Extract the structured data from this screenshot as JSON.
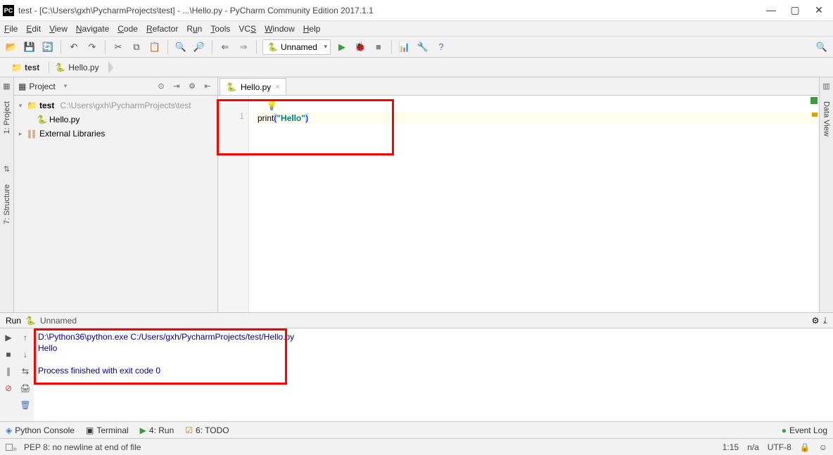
{
  "title": "test - [C:\\Users\\gxh\\PycharmProjects\\test] - ...\\Hello.py - PyCharm Community Edition 2017.1.1",
  "menu": [
    "File",
    "Edit",
    "View",
    "Navigate",
    "Code",
    "Refactor",
    "Run",
    "Tools",
    "VCS",
    "Window",
    "Help"
  ],
  "runConfig": "Unnamed",
  "breadcrumb": {
    "root": "test",
    "file": "Hello.py"
  },
  "sidebar": {
    "left": {
      "project": "1: Project",
      "structure": "7: Structure"
    },
    "right": {
      "dataview": "Data View"
    }
  },
  "projectPanel": {
    "label": "Project",
    "tree": {
      "rootName": "test",
      "rootPath": "C:\\Users\\gxh\\PycharmProjects\\test",
      "file": "Hello.py",
      "extLibs": "External Libraries"
    }
  },
  "editor": {
    "tabName": "Hello.py",
    "lineNo": "1",
    "code": {
      "fn": "print",
      "open": "(",
      "str": "\"Hello\"",
      "close": ")"
    }
  },
  "runPanel": {
    "label": "Run",
    "config": "Unnamed",
    "output": {
      "cmd": "D:\\Python36\\python.exe C:/Users/gxh/PycharmProjects/test/Hello.py",
      "out": "Hello",
      "exit": "Process finished with exit code 0"
    }
  },
  "bottom": {
    "console": "Python Console",
    "terminal": "Terminal",
    "run": "4: Run",
    "todo": "6: TODO",
    "eventLog": "Event Log"
  },
  "status": {
    "msg": "PEP 8: no newline at end of file",
    "pos": "1:15",
    "na": "n/a",
    "enc": "UTF-8"
  }
}
